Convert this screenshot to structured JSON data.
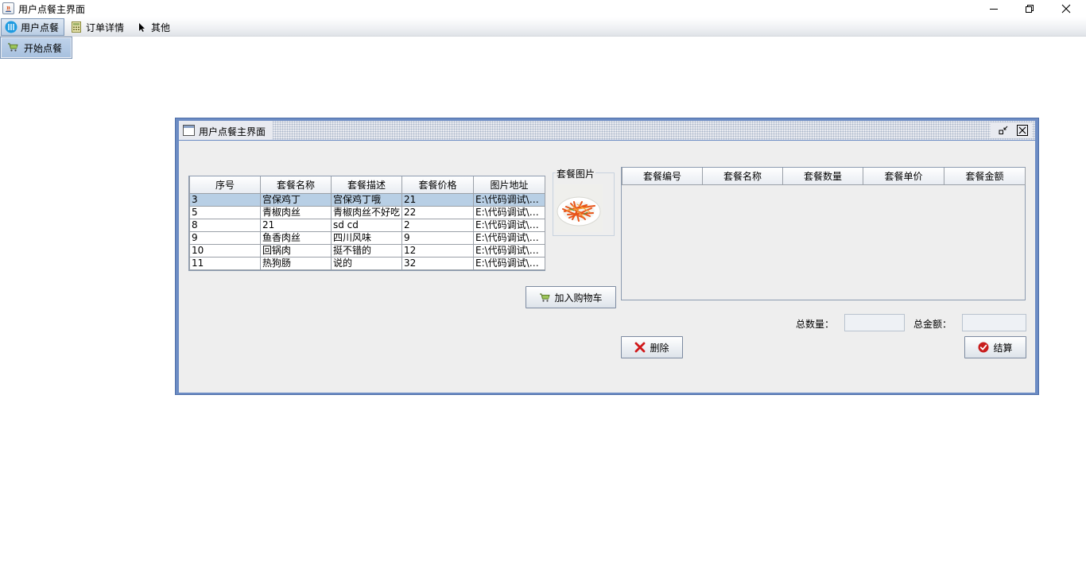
{
  "window": {
    "title": "用户点餐主界面"
  },
  "menubar": {
    "items": [
      {
        "label": "用户点餐",
        "icon": "order-icon"
      },
      {
        "label": "订单详情",
        "icon": "calculator-icon"
      },
      {
        "label": "其他",
        "icon": "cursor-icon"
      }
    ],
    "dropdown": {
      "items": [
        {
          "label": "开始点餐",
          "icon": "cart-icon"
        }
      ]
    }
  },
  "frame": {
    "title": "用户点餐主界面"
  },
  "menu_table": {
    "columns": [
      "序号",
      "套餐名称",
      "套餐描述",
      "套餐价格",
      "图片地址"
    ],
    "selected_row": 0,
    "rows": [
      [
        "3",
        "宫保鸡丁",
        "宫保鸡丁哦",
        "21",
        "E:\\代码调试\\订..."
      ],
      [
        "5",
        "青椒肉丝",
        "青椒肉丝不好吃",
        "22",
        "E:\\代码调试\\订..."
      ],
      [
        "8",
        "21",
        "sd cd",
        "2",
        "E:\\代码调试\\订..."
      ],
      [
        "9",
        "鱼香肉丝",
        "四川风味",
        "9",
        "E:\\代码调试\\订..."
      ],
      [
        "10",
        "回锅肉",
        "挺不错的",
        "12",
        "E:\\代码调试\\订..."
      ],
      [
        "11",
        "热狗肠",
        "说的",
        "32",
        "E:\\代码调试\\订..."
      ]
    ]
  },
  "image_panel": {
    "title": "套餐图片"
  },
  "cart_table": {
    "columns": [
      "套餐编号",
      "套餐名称",
      "套餐数量",
      "套餐单价",
      "套餐金额"
    ],
    "rows": []
  },
  "buttons": {
    "add_to_cart": "加入购物车",
    "delete": "删除",
    "checkout": "结算"
  },
  "totals": {
    "quantity_label": "总数量：",
    "quantity_value": "",
    "amount_label": "总金额：",
    "amount_value": ""
  }
}
